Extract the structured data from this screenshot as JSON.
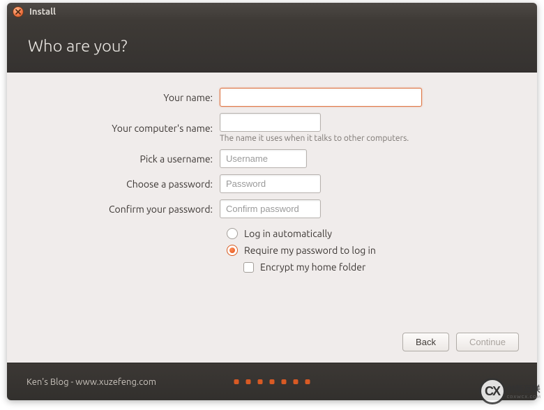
{
  "titlebar": {
    "title": "Install"
  },
  "header": {
    "heading": "Who are you?"
  },
  "form": {
    "name_label": "Your name:",
    "computer_label": "Your computer's name:",
    "computer_hint": "The name it uses when it talks to other computers.",
    "username_label": "Pick a username:",
    "username_placeholder": "Username",
    "password_label": "Choose a password:",
    "password_placeholder": "Password",
    "confirm_label": "Confirm your password:",
    "confirm_placeholder": "Confirm password"
  },
  "options": {
    "auto_login": "Log in automatically",
    "require_pw": "Require my password to log in",
    "encrypt": "Encrypt my home folder",
    "selected": "require_pw"
  },
  "buttons": {
    "back": "Back",
    "continue": "Continue"
  },
  "footer": {
    "text": "Ken's Blog - www.xuzefeng.com",
    "dots": 7
  },
  "watermark": {
    "logo": "CX",
    "text": "创新互联",
    "sub": "CDXWCX.COM"
  },
  "colors": {
    "accent": "#e0531c",
    "focus": "#e07746"
  }
}
